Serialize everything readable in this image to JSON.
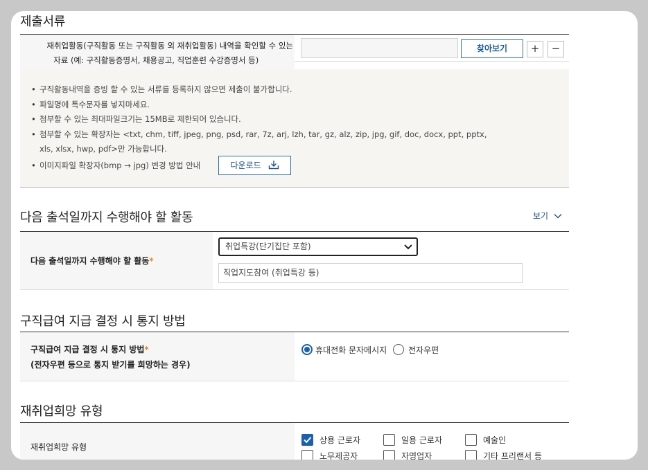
{
  "docs": {
    "title": "제출서류",
    "row_label_line1": "재취업활동(구직활동 또는 구직활동 외 재취업활동) 내역을 확인할 수 있는",
    "row_label_line2": "자료 (예: 구직활동증명서, 채용공고, 직업훈련 수강증명서 등)",
    "file_value": "",
    "browse_label": "찾아보기",
    "add_label": "+",
    "remove_label": "−",
    "notices": [
      "구직활동내역을 증빙 할 수 있는 서류를 등록하지 않으면 제출이 불가합니다.",
      "파일명에 특수문자를 넣지마세요.",
      "첨부할 수 있는 최대파일크기는 15MB로 제한되어 있습니다.",
      "첨부할 수 있는 확장자는 <txt, chm, tiff, jpeg, png, psd, rar, 7z, arj, lzh, tar, gz, alz, zip, jpg, gif, doc, docx, ppt, pptx,",
      "xls, xlsx, hwp, pdf>만 가능합니다.",
      "이미지파일 확장자(bmp → jpg) 변경 방법 안내"
    ],
    "download_label": "다운로드"
  },
  "activity": {
    "title": "다음 출석일까지 수행해야 할 활동",
    "toggle_label": "보기",
    "row_label": "다음 출석일까지 수행해야 할 활동",
    "required_mark": "*",
    "select_value": "취업특강(단기집단 포함)",
    "detail_value": "직업지도참여 (취업특강 등)"
  },
  "notify": {
    "title": "구직급여 지급 결정 시 통지 방법",
    "row_label_line1": "구직급여 지급 결정 시 통지 방법",
    "required_mark": "*",
    "row_label_line2": "(전자우편 등으로 통지 받기를 희망하는 경우)",
    "options": [
      {
        "label": "휴대전화 문자메시지",
        "selected": true
      },
      {
        "label": "전자우편",
        "selected": false
      }
    ]
  },
  "reemploy": {
    "title": "재취업희망 유형",
    "row_label": "재취업희망 유형",
    "options": [
      {
        "label": "상용 근로자",
        "checked": true
      },
      {
        "label": "일용 근로자",
        "checked": false
      },
      {
        "label": "예술인",
        "checked": false
      },
      {
        "label": "노무제공자",
        "checked": false
      },
      {
        "label": "자영업자",
        "checked": false
      },
      {
        "label": "기타 프리랜서 등",
        "checked": false
      }
    ]
  },
  "colors": {
    "accent": "#1a5fb4",
    "required": "#e58a1f",
    "label_bg": "#f6f6f6",
    "notice_bg": "#f6f5f1"
  }
}
